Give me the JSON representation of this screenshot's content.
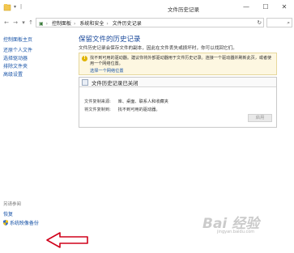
{
  "window": {
    "title": "文件历史记录",
    "minimize": "—",
    "maximize": "☐",
    "close": "✕"
  },
  "nav": {
    "back": "←",
    "forward": "→",
    "up": "↑",
    "breadcrumb": [
      "控制面板",
      "系统和安全",
      "文件历史记录"
    ],
    "separator": "›",
    "refresh": "↻",
    "search_icon": "⌕"
  },
  "sidebar": {
    "items": [
      {
        "label": "控制面板主页"
      },
      {
        "label": "还原个人文件"
      },
      {
        "label": "选择驱动器"
      },
      {
        "label": "排除文件夹"
      },
      {
        "label": "高级设置"
      }
    ],
    "see_also_title": "另请参阅",
    "see_also": [
      {
        "label": "恢复"
      },
      {
        "label": "系统映像备份",
        "icon": "shield-icon"
      }
    ]
  },
  "main": {
    "heading": "保留文件的历史记录",
    "description": "文件历史记录会保存文件的副本，因此在文件丢失或损坏时，你可以找回它们。",
    "warning": {
      "icon": "!",
      "text": "找不到可用的驱动器。建议你将外部驱动器用于文件历史记录。连接一个驱动器并刷新此页，或者使用一个网络位置。",
      "link": "选择一个网络位置"
    },
    "status_panel": {
      "title": "文件历史记录已关闭",
      "rows": [
        {
          "label": "文件复制来源:",
          "value": "库、桌面、联系人和收藏夹"
        },
        {
          "label": "将文件复制到:",
          "value": "找不到可用的驱动器。"
        }
      ]
    },
    "enable_button": "启用"
  },
  "overlay": {
    "watermark": "Bai 经验",
    "watermark_sub": "jingyan.baidu.com",
    "arrow_color": "#d0021b"
  }
}
